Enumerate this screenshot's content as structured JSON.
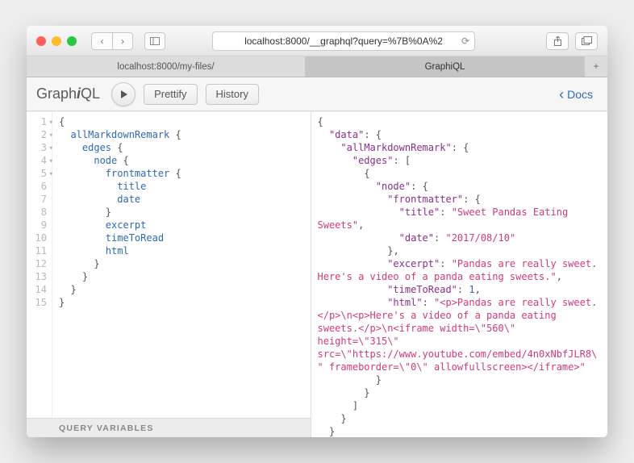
{
  "browser": {
    "url": "localhost:8000/__graphql?query=%7B%0A%2",
    "tabs": {
      "inactive": "localhost:8000/my-files/",
      "active": "GraphiQL"
    }
  },
  "toolbar": {
    "logo_pre": "Graph",
    "logo_i": "i",
    "logo_post": "QL",
    "prettify": "Prettify",
    "history": "History",
    "docs": "Docs"
  },
  "query_lines": [
    "{",
    "  allMarkdownRemark {",
    "    edges {",
    "      node {",
    "        frontmatter {",
    "          title",
    "          date",
    "        }",
    "        excerpt",
    "        timeToRead",
    "        html",
    "      }",
    "    }",
    "  }",
    "}"
  ],
  "vars_label": "QUERY VARIABLES",
  "result": {
    "data": {
      "allMarkdownRemark": {
        "edges": [
          {
            "node": {
              "frontmatter": {
                "title": "Sweet Pandas Eating Sweets",
                "date": "2017/08/10"
              },
              "excerpt": "Pandas are really sweet. Here's a video of a panda eating sweets.",
              "timeToRead": 1,
              "html": "<p>Pandas are really sweet.</p>\\n<p>Here's a video of a panda eating sweets.</p>\\n<iframe width=\\\"560\\\" height=\\\"315\\\" src=\\\"https://www.youtube.com/embed/4n0xNbfJLR8\\\" frameborder=\\\"0\\\" allowfullscreen></iframe>"
            }
          }
        ]
      }
    }
  }
}
